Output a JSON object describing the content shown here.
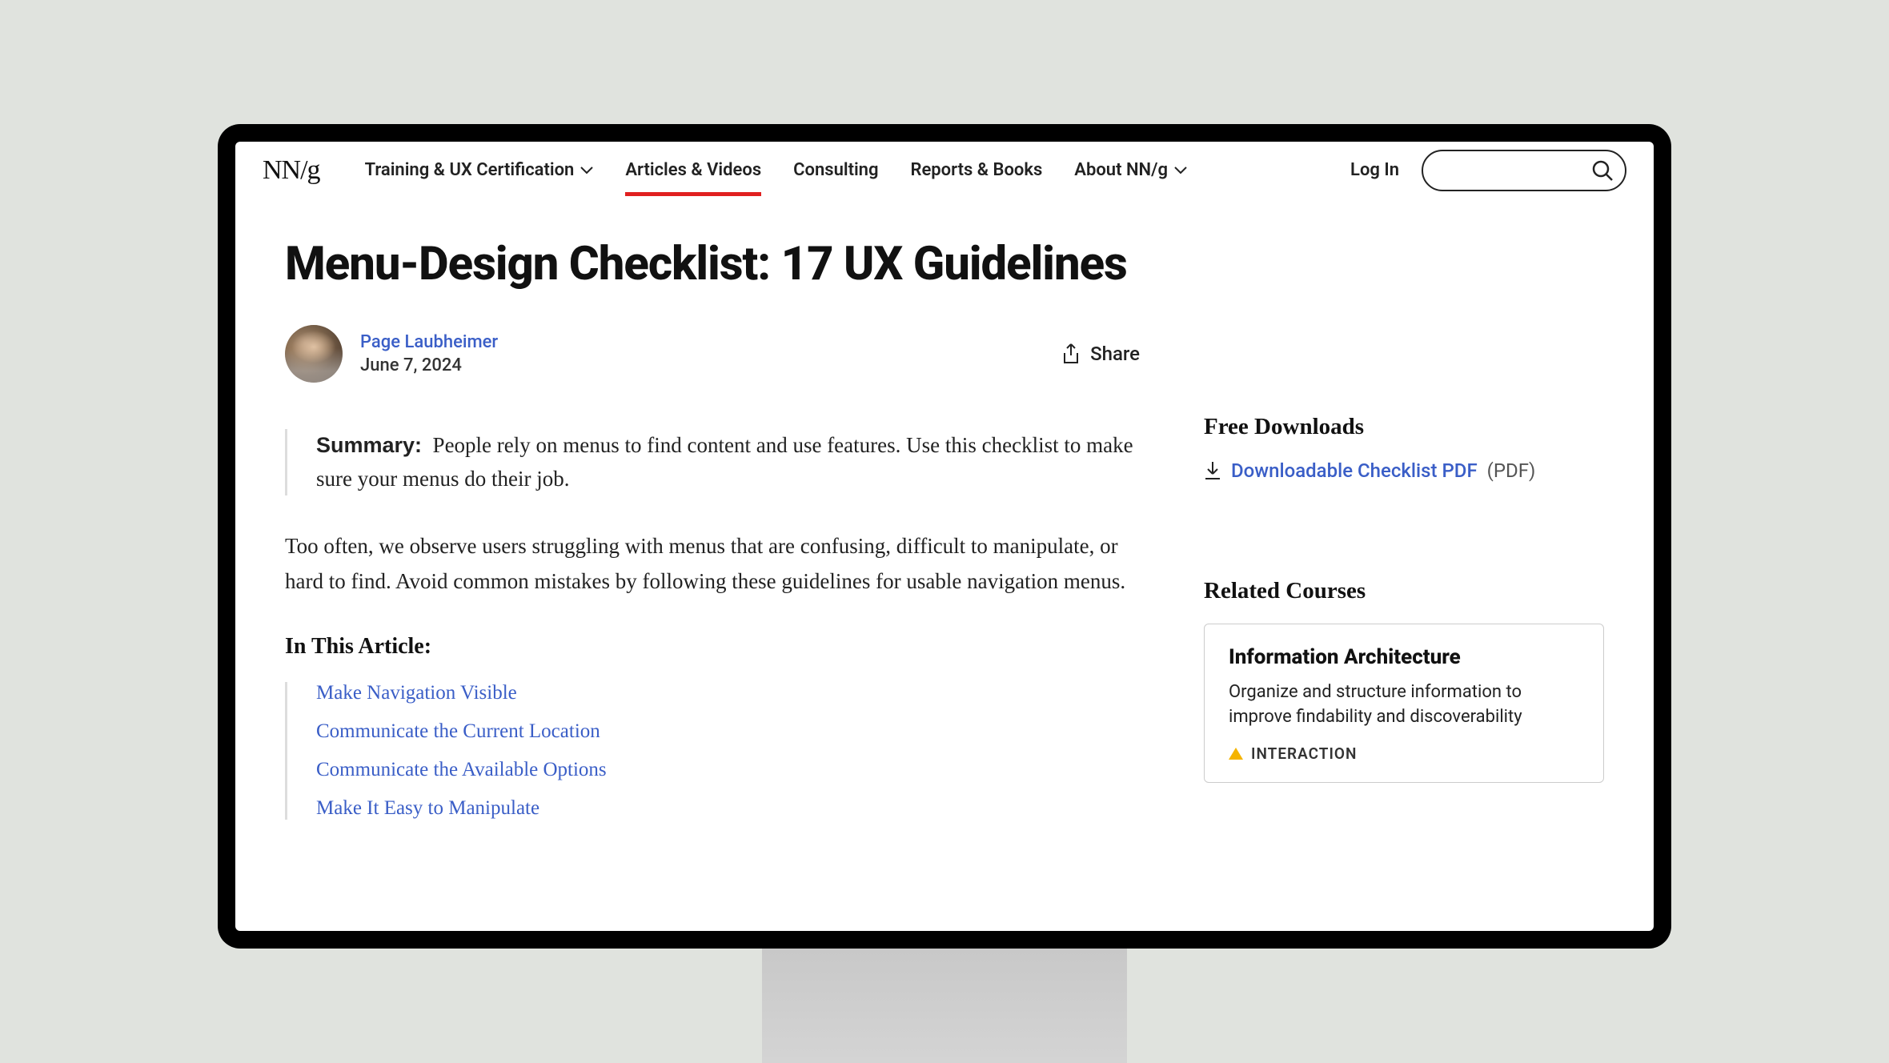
{
  "logo": "NN/g",
  "nav": {
    "items": [
      {
        "label": "Training & UX Certification",
        "has_dropdown": true
      },
      {
        "label": "Articles & Videos",
        "has_dropdown": false,
        "active": true
      },
      {
        "label": "Consulting",
        "has_dropdown": false
      },
      {
        "label": "Reports & Books",
        "has_dropdown": false
      },
      {
        "label": "About NN/g",
        "has_dropdown": true
      }
    ],
    "login": "Log In"
  },
  "article": {
    "title": "Menu-Design Checklist: 17 UX Guidelines",
    "author": "Page Laubheimer",
    "date": "June 7, 2024",
    "share_label": "Share",
    "summary_label": "Summary:",
    "summary_text": "People rely on menus to find content and use features. Use this checklist to make sure your menus do their job.",
    "intro_para": "Too often, we observe users struggling with menus that are confusing, difficult to manipulate, or hard to find. Avoid common mistakes by following these guidelines for usable navigation menus.",
    "toc_heading": "In This Article:",
    "toc": [
      "Make Navigation Visible",
      "Communicate the Current Location",
      "Communicate the Available Options",
      "Make It Easy to Manipulate"
    ]
  },
  "sidebar": {
    "downloads_heading": "Free Downloads",
    "download_link": "Downloadable Checklist PDF",
    "download_ext": "(PDF)",
    "related_heading": "Related Courses",
    "course": {
      "title": "Information Architecture",
      "desc": "Organize and structure information to improve findability and discoverability",
      "tag": "INTERACTION"
    }
  }
}
